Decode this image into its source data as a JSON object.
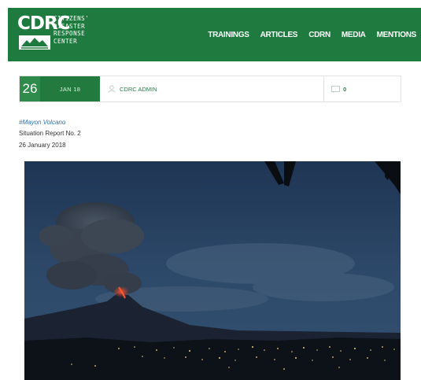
{
  "brand": {
    "logo_main": "CDRC",
    "logo_lines": [
      "CITIZENS'",
      "DISASTER",
      "RESPONSE",
      "CENTER"
    ],
    "color": "#1e7a3e"
  },
  "nav": {
    "items": [
      "TRAININGS",
      "ARTICLES",
      "CDRN",
      "MEDIA",
      "MENTIONS"
    ]
  },
  "meta": {
    "day": "26",
    "month_year": "JAN 18",
    "author_icon": "user-icon",
    "author": "CDRC ADMIN",
    "comment_icon": "comment-icon",
    "comments": "0"
  },
  "article": {
    "tag": "#Mayon Volcano",
    "line2": "Situation Report No. 2",
    "line3": "26 January 2018"
  }
}
